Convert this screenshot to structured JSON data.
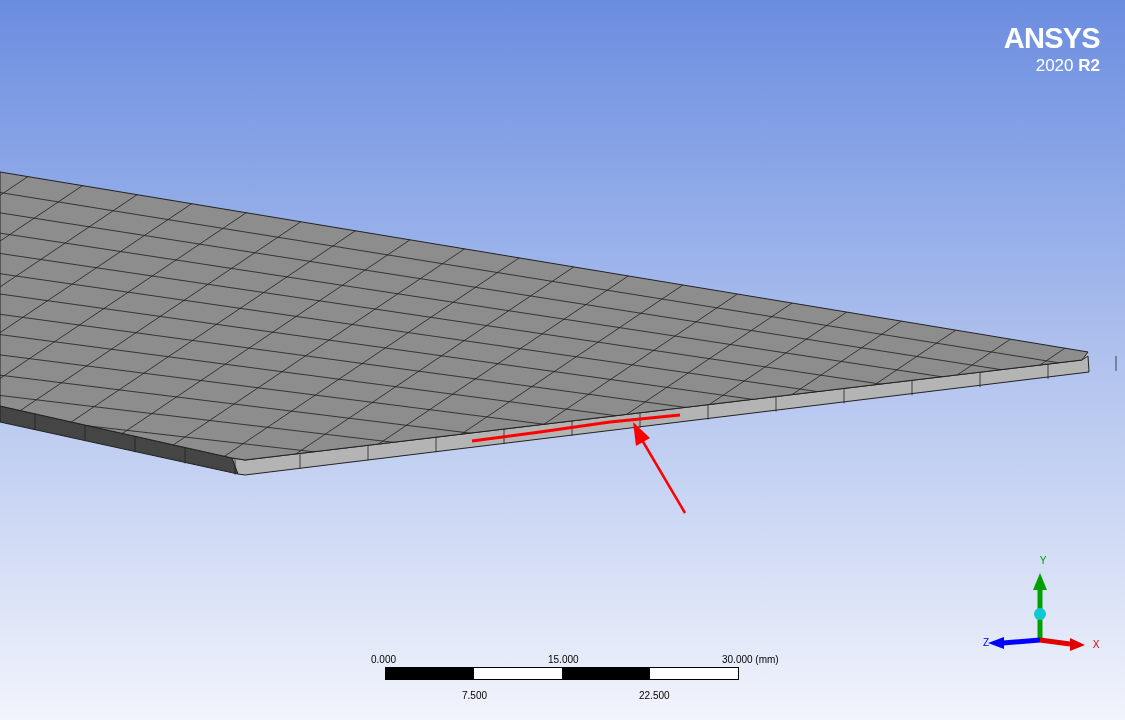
{
  "logo": {
    "name": "ANSYS",
    "version": "2020",
    "release": "R2"
  },
  "scale_bar": {
    "top_labels": [
      "0.000",
      "15.000",
      "30.000 (mm)"
    ],
    "bottom_labels": [
      "7.500",
      "22.500"
    ]
  },
  "triad": {
    "axes": [
      {
        "label": "Y",
        "color": "#00a000"
      },
      {
        "label": "Z",
        "color": "#0000ff"
      },
      {
        "label": "X",
        "color": "#e00000"
      }
    ]
  }
}
